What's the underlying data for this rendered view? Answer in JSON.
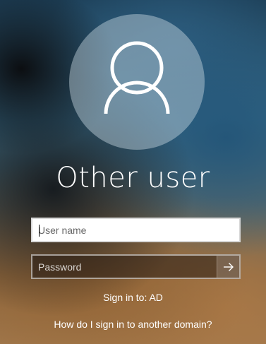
{
  "user": {
    "display_name": "Other user",
    "avatar_icon": "person-outline-icon"
  },
  "login_form": {
    "username_placeholder": "User name",
    "username_value": "",
    "password_placeholder": "Password",
    "password_value": "",
    "submit_icon": "arrow-right-icon"
  },
  "sign_in_to": "Sign in to: AD",
  "help_link": "How do I sign in to another domain?",
  "colors": {
    "text": "#ffffff",
    "input_background": "#ffffff",
    "input_border": "#d8d8d8"
  }
}
